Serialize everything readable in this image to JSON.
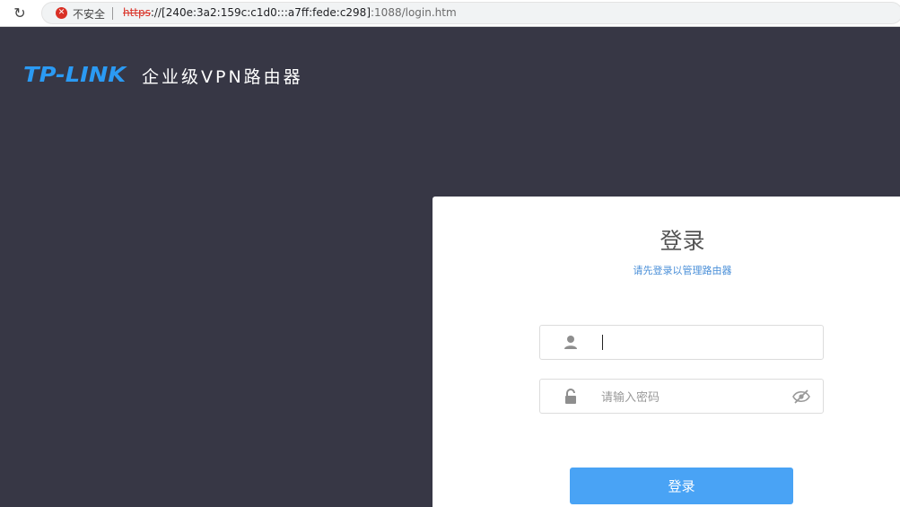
{
  "browser": {
    "reload_glyph": "↻",
    "security_label": "不安全",
    "url_scheme": "https",
    "url_sep": "://",
    "url_host": "[240e:3a2:159c:c1d0:::a7ff:fede:c298]",
    "url_path": ":1088/login.htm"
  },
  "brand": {
    "logo_text": "TP-LINK",
    "subtitle": "企业级VPN路由器"
  },
  "login": {
    "title": "登录",
    "subtitle": "请先登录以管理路由器",
    "username_value": "",
    "password_placeholder": "请输入密码",
    "submit_label": "登录"
  },
  "colors": {
    "page_background": "#373745",
    "brand_blue": "#2b9af3",
    "button_blue": "#49a3f5",
    "subtitle_blue": "#4a8fd8",
    "insecure_red": "#d93025"
  },
  "icons": {
    "reload": "reload-icon",
    "warning": "not-secure-warning-icon",
    "user": "user-icon",
    "lock": "lock-icon",
    "eye": "eye-slash-icon"
  }
}
